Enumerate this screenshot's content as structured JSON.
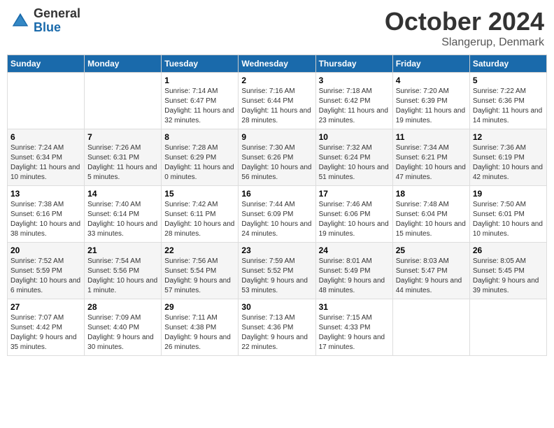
{
  "header": {
    "logo_general": "General",
    "logo_blue": "Blue",
    "title": "October 2024",
    "location": "Slangerup, Denmark"
  },
  "days_of_week": [
    "Sunday",
    "Monday",
    "Tuesday",
    "Wednesday",
    "Thursday",
    "Friday",
    "Saturday"
  ],
  "weeks": [
    [
      {
        "day": "",
        "sunrise": "",
        "sunset": "",
        "daylight": ""
      },
      {
        "day": "",
        "sunrise": "",
        "sunset": "",
        "daylight": ""
      },
      {
        "day": "1",
        "sunrise": "Sunrise: 7:14 AM",
        "sunset": "Sunset: 6:47 PM",
        "daylight": "Daylight: 11 hours and 32 minutes."
      },
      {
        "day": "2",
        "sunrise": "Sunrise: 7:16 AM",
        "sunset": "Sunset: 6:44 PM",
        "daylight": "Daylight: 11 hours and 28 minutes."
      },
      {
        "day": "3",
        "sunrise": "Sunrise: 7:18 AM",
        "sunset": "Sunset: 6:42 PM",
        "daylight": "Daylight: 11 hours and 23 minutes."
      },
      {
        "day": "4",
        "sunrise": "Sunrise: 7:20 AM",
        "sunset": "Sunset: 6:39 PM",
        "daylight": "Daylight: 11 hours and 19 minutes."
      },
      {
        "day": "5",
        "sunrise": "Sunrise: 7:22 AM",
        "sunset": "Sunset: 6:36 PM",
        "daylight": "Daylight: 11 hours and 14 minutes."
      }
    ],
    [
      {
        "day": "6",
        "sunrise": "Sunrise: 7:24 AM",
        "sunset": "Sunset: 6:34 PM",
        "daylight": "Daylight: 11 hours and 10 minutes."
      },
      {
        "day": "7",
        "sunrise": "Sunrise: 7:26 AM",
        "sunset": "Sunset: 6:31 PM",
        "daylight": "Daylight: 11 hours and 5 minutes."
      },
      {
        "day": "8",
        "sunrise": "Sunrise: 7:28 AM",
        "sunset": "Sunset: 6:29 PM",
        "daylight": "Daylight: 11 hours and 0 minutes."
      },
      {
        "day": "9",
        "sunrise": "Sunrise: 7:30 AM",
        "sunset": "Sunset: 6:26 PM",
        "daylight": "Daylight: 10 hours and 56 minutes."
      },
      {
        "day": "10",
        "sunrise": "Sunrise: 7:32 AM",
        "sunset": "Sunset: 6:24 PM",
        "daylight": "Daylight: 10 hours and 51 minutes."
      },
      {
        "day": "11",
        "sunrise": "Sunrise: 7:34 AM",
        "sunset": "Sunset: 6:21 PM",
        "daylight": "Daylight: 10 hours and 47 minutes."
      },
      {
        "day": "12",
        "sunrise": "Sunrise: 7:36 AM",
        "sunset": "Sunset: 6:19 PM",
        "daylight": "Daylight: 10 hours and 42 minutes."
      }
    ],
    [
      {
        "day": "13",
        "sunrise": "Sunrise: 7:38 AM",
        "sunset": "Sunset: 6:16 PM",
        "daylight": "Daylight: 10 hours and 38 minutes."
      },
      {
        "day": "14",
        "sunrise": "Sunrise: 7:40 AM",
        "sunset": "Sunset: 6:14 PM",
        "daylight": "Daylight: 10 hours and 33 minutes."
      },
      {
        "day": "15",
        "sunrise": "Sunrise: 7:42 AM",
        "sunset": "Sunset: 6:11 PM",
        "daylight": "Daylight: 10 hours and 28 minutes."
      },
      {
        "day": "16",
        "sunrise": "Sunrise: 7:44 AM",
        "sunset": "Sunset: 6:09 PM",
        "daylight": "Daylight: 10 hours and 24 minutes."
      },
      {
        "day": "17",
        "sunrise": "Sunrise: 7:46 AM",
        "sunset": "Sunset: 6:06 PM",
        "daylight": "Daylight: 10 hours and 19 minutes."
      },
      {
        "day": "18",
        "sunrise": "Sunrise: 7:48 AM",
        "sunset": "Sunset: 6:04 PM",
        "daylight": "Daylight: 10 hours and 15 minutes."
      },
      {
        "day": "19",
        "sunrise": "Sunrise: 7:50 AM",
        "sunset": "Sunset: 6:01 PM",
        "daylight": "Daylight: 10 hours and 10 minutes."
      }
    ],
    [
      {
        "day": "20",
        "sunrise": "Sunrise: 7:52 AM",
        "sunset": "Sunset: 5:59 PM",
        "daylight": "Daylight: 10 hours and 6 minutes."
      },
      {
        "day": "21",
        "sunrise": "Sunrise: 7:54 AM",
        "sunset": "Sunset: 5:56 PM",
        "daylight": "Daylight: 10 hours and 1 minute."
      },
      {
        "day": "22",
        "sunrise": "Sunrise: 7:56 AM",
        "sunset": "Sunset: 5:54 PM",
        "daylight": "Daylight: 9 hours and 57 minutes."
      },
      {
        "day": "23",
        "sunrise": "Sunrise: 7:59 AM",
        "sunset": "Sunset: 5:52 PM",
        "daylight": "Daylight: 9 hours and 53 minutes."
      },
      {
        "day": "24",
        "sunrise": "Sunrise: 8:01 AM",
        "sunset": "Sunset: 5:49 PM",
        "daylight": "Daylight: 9 hours and 48 minutes."
      },
      {
        "day": "25",
        "sunrise": "Sunrise: 8:03 AM",
        "sunset": "Sunset: 5:47 PM",
        "daylight": "Daylight: 9 hours and 44 minutes."
      },
      {
        "day": "26",
        "sunrise": "Sunrise: 8:05 AM",
        "sunset": "Sunset: 5:45 PM",
        "daylight": "Daylight: 9 hours and 39 minutes."
      }
    ],
    [
      {
        "day": "27",
        "sunrise": "Sunrise: 7:07 AM",
        "sunset": "Sunset: 4:42 PM",
        "daylight": "Daylight: 9 hours and 35 minutes."
      },
      {
        "day": "28",
        "sunrise": "Sunrise: 7:09 AM",
        "sunset": "Sunset: 4:40 PM",
        "daylight": "Daylight: 9 hours and 30 minutes."
      },
      {
        "day": "29",
        "sunrise": "Sunrise: 7:11 AM",
        "sunset": "Sunset: 4:38 PM",
        "daylight": "Daylight: 9 hours and 26 minutes."
      },
      {
        "day": "30",
        "sunrise": "Sunrise: 7:13 AM",
        "sunset": "Sunset: 4:36 PM",
        "daylight": "Daylight: 9 hours and 22 minutes."
      },
      {
        "day": "31",
        "sunrise": "Sunrise: 7:15 AM",
        "sunset": "Sunset: 4:33 PM",
        "daylight": "Daylight: 9 hours and 17 minutes."
      },
      {
        "day": "",
        "sunrise": "",
        "sunset": "",
        "daylight": ""
      },
      {
        "day": "",
        "sunrise": "",
        "sunset": "",
        "daylight": ""
      }
    ]
  ]
}
